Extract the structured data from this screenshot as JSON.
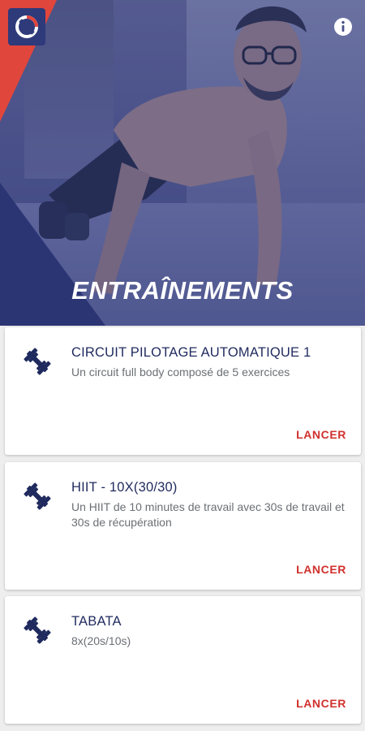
{
  "header": {
    "title": "ENTRAÎNEMENTS",
    "logo_icon": "app-logo",
    "info_icon": "info-icon"
  },
  "colors": {
    "navy": "#1f2a5e",
    "accent_red": "#d0312d",
    "triangle_red": "#e1463c",
    "triangle_navy": "#2b3574"
  },
  "workouts": [
    {
      "title": "CIRCUIT PILOTAGE AUTOMATIQUE 1",
      "description": "Un circuit full body composé de 5 exercices",
      "action": "LANCER",
      "icon": "dumbbell-icon"
    },
    {
      "title": "HIIT - 10X(30/30)",
      "description": "Un HIIT de 10 minutes de travail avec 30s de travail et 30s de récupération",
      "action": "LANCER",
      "icon": "dumbbell-icon"
    },
    {
      "title": "TABATA",
      "description": "8x(20s/10s)",
      "action": "LANCER",
      "icon": "dumbbell-icon"
    }
  ]
}
